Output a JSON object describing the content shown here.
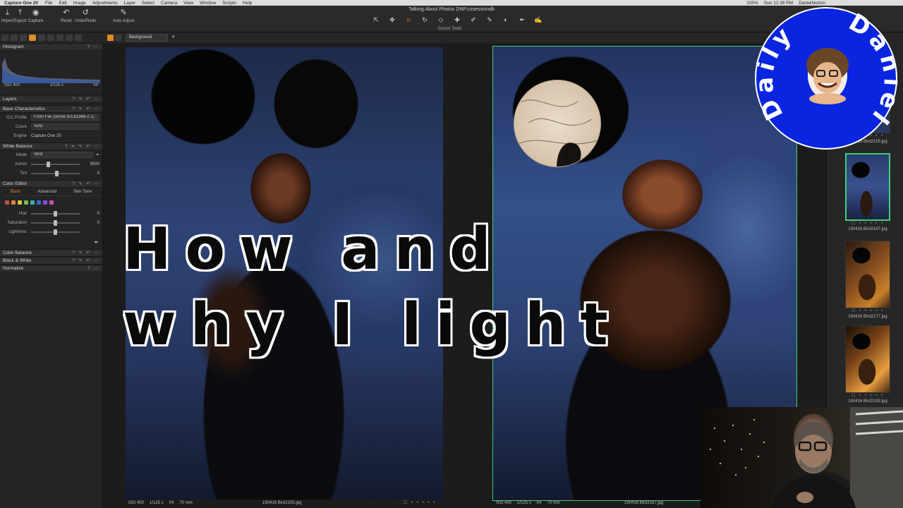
{
  "menubar": {
    "app": "Capture One 20",
    "items": [
      "File",
      "Edit",
      "Image",
      "Adjustments",
      "Layer",
      "Select",
      "Camera",
      "View",
      "Window",
      "Scripts",
      "Help"
    ],
    "battery": "100%",
    "clock": "Sun 12:38 PM",
    "user": "DanielNorton"
  },
  "toolbar": {
    "import": "Import",
    "export": "Export",
    "capture": "Capture",
    "reset": "Reset",
    "undo_redo": "Undo/Redo",
    "auto_adjust": "Auto Adjust",
    "doc_title": "Talking About Photos DNP.cosessiondb",
    "cursor_tools_label": "Cursor Tools"
  },
  "subbar": {
    "layer": "Background"
  },
  "left_panel": {
    "histogram": {
      "title": "Histogram",
      "iso": "ISO 400",
      "shutter": "1/125 s",
      "aperture": "f/4"
    },
    "layers": {
      "title": "Layers"
    },
    "base": {
      "title": "Base Characteristics",
      "icc_label": "ICC Profile",
      "icc_value": "From File (sRGB IEC61966-2.1)",
      "curve_label": "Curve",
      "curve_value": "Auto",
      "engine_label": "Engine",
      "engine_value": "Capture One 20"
    },
    "white_balance": {
      "title": "White Balance",
      "mode_label": "Mode",
      "mode_value": "Shot",
      "kelvin_label": "Kelvin",
      "kelvin_value": "5000",
      "tint_label": "Tint",
      "tint_value": "0"
    },
    "color_editor": {
      "title": "Color Editor",
      "tabs": [
        "Basic",
        "Advanced",
        "Skin Tone"
      ],
      "hue_label": "Hue",
      "hue_value": "0",
      "saturation_label": "Saturation",
      "saturation_value": "0",
      "lightness_label": "Lightness",
      "swatches": [
        "#c84a4a",
        "#d8863a",
        "#d8c43a",
        "#6fc04a",
        "#3ab0b0",
        "#3a6ad8",
        "#8a4ad8",
        "#c84ab0"
      ]
    },
    "color_balance": {
      "title": "Color Balance"
    },
    "black_white": {
      "title": "Black & White"
    },
    "normalize": {
      "title": "Normalize"
    }
  },
  "viewer": {
    "left": {
      "iso": "ISO 400",
      "shutter": "1/125 s",
      "aperture": "f/4",
      "focal": "70 mm",
      "file": "190416 Bird2155.jpg"
    },
    "right": {
      "iso": "ISO 400",
      "shutter": "1/125 s",
      "aperture": "f/4",
      "focal": "70 mm",
      "file": "190416 Bird2167.jpg"
    }
  },
  "browser": {
    "thumbs": [
      {
        "name": "190416 Bird2155.jpg"
      },
      {
        "name": "190416 Bird2167.jpg"
      },
      {
        "name": "190416 Bird2177.jpg"
      },
      {
        "name": "190416 Bird2183.jpg"
      }
    ]
  },
  "overlay": {
    "line1": "How and",
    "line2": "why I light"
  },
  "logo": {
    "word1": "Daily",
    "word2": "Daniel",
    "bg_color": "#0a25e0"
  },
  "colors": {
    "accent": "#e08a2a",
    "selection": "#3ecf7a"
  }
}
